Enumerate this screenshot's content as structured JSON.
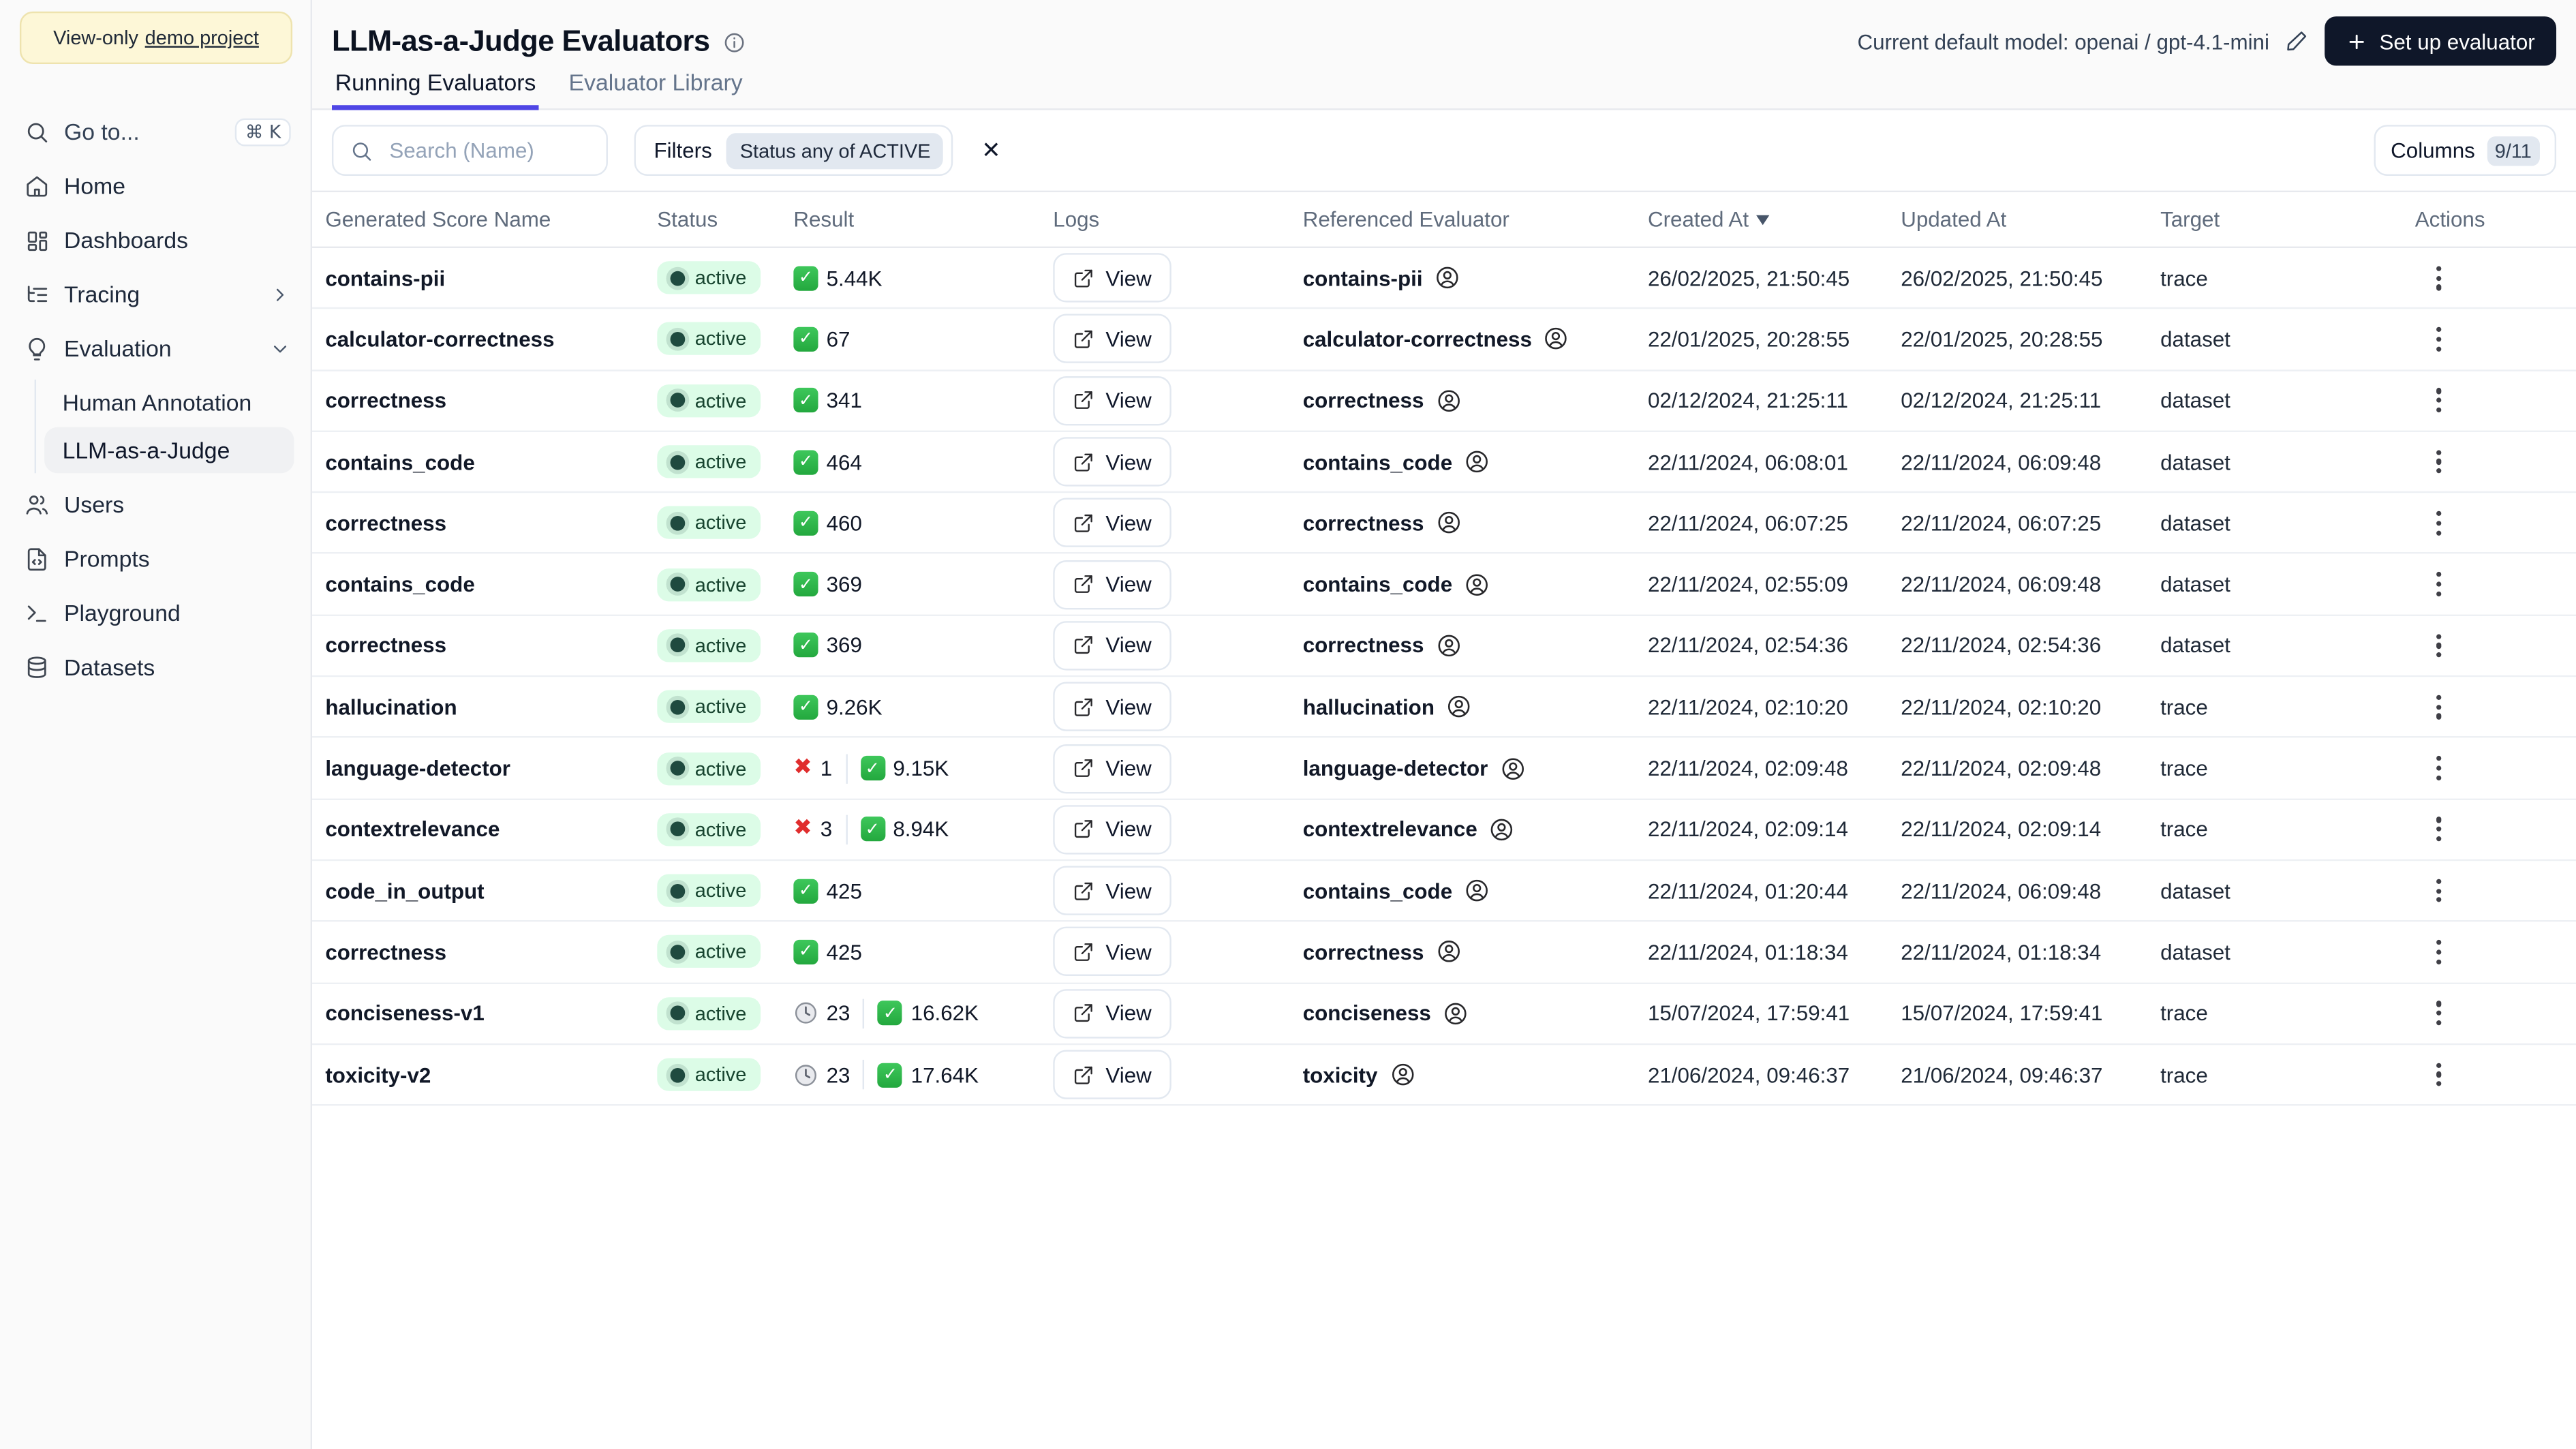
{
  "banner": {
    "text": "View-only",
    "link_text": "demo project"
  },
  "sidebar": {
    "goto": {
      "label": "Go to...",
      "shortcut": "⌘ K",
      "icon": "search-icon"
    },
    "items": [
      {
        "label": "Home",
        "icon": "home-icon"
      },
      {
        "label": "Dashboards",
        "icon": "dashboards-icon"
      },
      {
        "label": "Tracing",
        "icon": "tracing-icon",
        "chevron": "right"
      },
      {
        "label": "Evaluation",
        "icon": "lightbulb-icon",
        "chevron": "down"
      }
    ],
    "evaluation_children": [
      {
        "label": "Human Annotation",
        "active": false
      },
      {
        "label": "LLM-as-a-Judge",
        "active": true
      }
    ],
    "items_after": [
      {
        "label": "Users",
        "icon": "users-icon"
      },
      {
        "label": "Prompts",
        "icon": "file-code-icon"
      },
      {
        "label": "Playground",
        "icon": "terminal-icon"
      },
      {
        "label": "Datasets",
        "icon": "database-icon"
      }
    ]
  },
  "header": {
    "title": "LLM-as-a-Judge Evaluators",
    "model_label": "Current default model: openai / gpt-4.1-mini",
    "setup_button": "Set up evaluator"
  },
  "tabs": [
    {
      "label": "Running Evaluators",
      "active": true
    },
    {
      "label": "Evaluator Library",
      "active": false
    }
  ],
  "toolbar": {
    "search_placeholder": "Search (Name)",
    "filters_label": "Filters",
    "filter_chip": "Status any of ACTIVE",
    "columns_label": "Columns",
    "columns_count": "9/11"
  },
  "table": {
    "view_label": "View",
    "columns": [
      "Generated Score Name",
      "Status",
      "Result",
      "Logs",
      "Referenced Evaluator",
      "Created At",
      "Updated At",
      "Target",
      "Actions"
    ],
    "sorted_column": "Created At",
    "sort_direction": "desc",
    "rows": [
      {
        "name": "contains-pii",
        "status": "active",
        "result": {
          "error": null,
          "pending": null,
          "success": "5.44K"
        },
        "referenced": "contains-pii",
        "created_at": "26/02/2025, 21:50:45",
        "updated_at": "26/02/2025, 21:50:45",
        "target": "trace"
      },
      {
        "name": "calculator-correctness",
        "status": "active",
        "result": {
          "error": null,
          "pending": null,
          "success": "67"
        },
        "referenced": "calculator-correctness",
        "created_at": "22/01/2025, 20:28:55",
        "updated_at": "22/01/2025, 20:28:55",
        "target": "dataset"
      },
      {
        "name": "correctness",
        "status": "active",
        "result": {
          "error": null,
          "pending": null,
          "success": "341"
        },
        "referenced": "correctness",
        "created_at": "02/12/2024, 21:25:11",
        "updated_at": "02/12/2024, 21:25:11",
        "target": "dataset"
      },
      {
        "name": "contains_code",
        "status": "active",
        "result": {
          "error": null,
          "pending": null,
          "success": "464"
        },
        "referenced": "contains_code",
        "created_at": "22/11/2024, 06:08:01",
        "updated_at": "22/11/2024, 06:09:48",
        "target": "dataset"
      },
      {
        "name": "correctness",
        "status": "active",
        "result": {
          "error": null,
          "pending": null,
          "success": "460"
        },
        "referenced": "correctness",
        "created_at": "22/11/2024, 06:07:25",
        "updated_at": "22/11/2024, 06:07:25",
        "target": "dataset"
      },
      {
        "name": "contains_code",
        "status": "active",
        "result": {
          "error": null,
          "pending": null,
          "success": "369"
        },
        "referenced": "contains_code",
        "created_at": "22/11/2024, 02:55:09",
        "updated_at": "22/11/2024, 06:09:48",
        "target": "dataset"
      },
      {
        "name": "correctness",
        "status": "active",
        "result": {
          "error": null,
          "pending": null,
          "success": "369"
        },
        "referenced": "correctness",
        "created_at": "22/11/2024, 02:54:36",
        "updated_at": "22/11/2024, 02:54:36",
        "target": "dataset"
      },
      {
        "name": "hallucination",
        "status": "active",
        "result": {
          "error": null,
          "pending": null,
          "success": "9.26K"
        },
        "referenced": "hallucination",
        "created_at": "22/11/2024, 02:10:20",
        "updated_at": "22/11/2024, 02:10:20",
        "target": "trace"
      },
      {
        "name": "language-detector",
        "status": "active",
        "result": {
          "error": "1",
          "pending": null,
          "success": "9.15K"
        },
        "referenced": "language-detector",
        "created_at": "22/11/2024, 02:09:48",
        "updated_at": "22/11/2024, 02:09:48",
        "target": "trace"
      },
      {
        "name": "contextrelevance",
        "status": "active",
        "result": {
          "error": "3",
          "pending": null,
          "success": "8.94K"
        },
        "referenced": "contextrelevance",
        "created_at": "22/11/2024, 02:09:14",
        "updated_at": "22/11/2024, 02:09:14",
        "target": "trace"
      },
      {
        "name": "code_in_output",
        "status": "active",
        "result": {
          "error": null,
          "pending": null,
          "success": "425"
        },
        "referenced": "contains_code",
        "created_at": "22/11/2024, 01:20:44",
        "updated_at": "22/11/2024, 06:09:48",
        "target": "dataset"
      },
      {
        "name": "correctness",
        "status": "active",
        "result": {
          "error": null,
          "pending": null,
          "success": "425"
        },
        "referenced": "correctness",
        "created_at": "22/11/2024, 01:18:34",
        "updated_at": "22/11/2024, 01:18:34",
        "target": "dataset"
      },
      {
        "name": "conciseness-v1",
        "status": "active",
        "result": {
          "error": null,
          "pending": "23",
          "success": "16.62K"
        },
        "referenced": "conciseness",
        "created_at": "15/07/2024, 17:59:41",
        "updated_at": "15/07/2024, 17:59:41",
        "target": "trace"
      },
      {
        "name": "toxicity-v2",
        "status": "active",
        "result": {
          "error": null,
          "pending": "23",
          "success": "17.64K"
        },
        "referenced": "toxicity",
        "created_at": "21/06/2024, 09:46:37",
        "updated_at": "21/06/2024, 09:46:37",
        "target": "trace"
      }
    ]
  },
  "colors": {
    "accent": "#4f46e5",
    "active_badge_bg": "#dcfce7",
    "success_green": "#23a83e",
    "error_red": "#e02d2d",
    "dark_button": "#0f1729"
  }
}
